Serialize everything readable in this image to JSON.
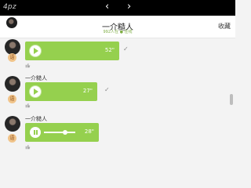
{
  "status_bar": {
    "app_label": "4pz",
    "nav_prev": "‹",
    "nav_next": "›"
  },
  "header": {
    "title": "一介糙人",
    "subtitle": "992人在 ● 在线",
    "action_label": "收藏"
  },
  "messages": [
    {
      "badge": "语",
      "duration": "52\"",
      "state": "play"
    },
    {
      "sender": "一介糙人",
      "badge": "语",
      "duration": "27\"",
      "state": "play"
    },
    {
      "sender": "一介糙人",
      "badge": "语",
      "duration": "28\"",
      "state": "pause",
      "progress": 0.7
    }
  ],
  "colors": {
    "bubble": "#95d04e",
    "online": "#7fae45",
    "top_bar": "#000000"
  },
  "icons": [
    "chevron-left-icon",
    "chevron-right-icon",
    "play-icon",
    "pause-icon",
    "check-icon",
    "thumb-up-icon"
  ]
}
